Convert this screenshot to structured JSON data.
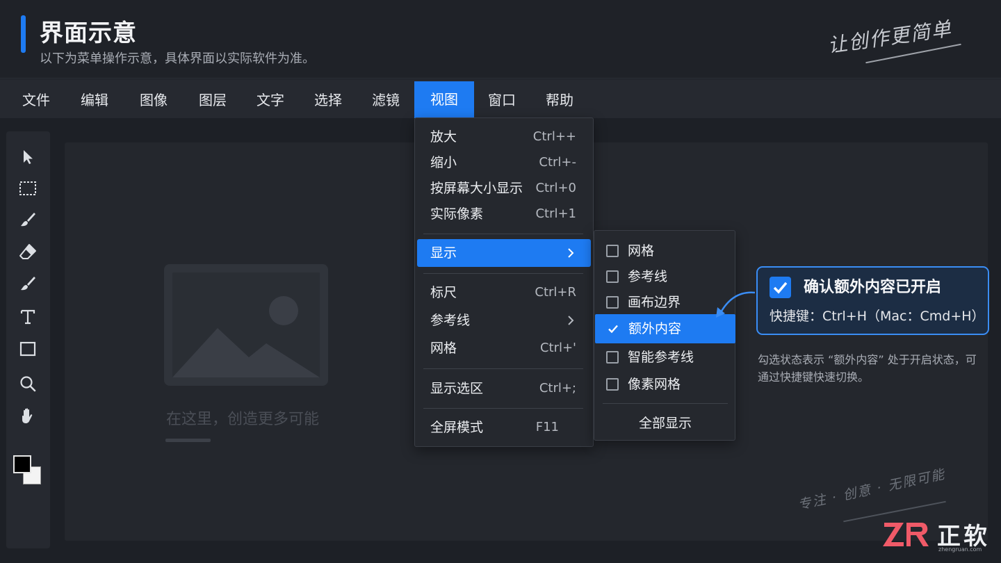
{
  "header": {
    "title": "界面示意",
    "subtitle": "以下为菜单操作示意，具体界面以实际软件为准。",
    "slogan": "让创作更简单"
  },
  "menubar": {
    "items": [
      {
        "label": "文件"
      },
      {
        "label": "编辑"
      },
      {
        "label": "图像"
      },
      {
        "label": "图层"
      },
      {
        "label": "文字"
      },
      {
        "label": "选择"
      },
      {
        "label": "滤镜"
      },
      {
        "label": "视图",
        "active": true
      },
      {
        "label": "窗口"
      },
      {
        "label": "帮助"
      }
    ]
  },
  "toolbar": {
    "tools": [
      "pointer-icon",
      "marquee-icon",
      "brush-icon",
      "eraser-icon",
      "paint-brush-icon",
      "text-tool-icon",
      "rectangle-icon",
      "zoom-icon",
      "hand-icon"
    ]
  },
  "canvas": {
    "placeholder_caption": "在这里，创造更多可能"
  },
  "view_menu": {
    "items": [
      {
        "label": "放大",
        "shortcut": "Ctrl++"
      },
      {
        "label": "缩小",
        "shortcut": "Ctrl+-"
      },
      {
        "label": "按屏幕大小显示",
        "shortcut": "Ctrl+0"
      },
      {
        "label": "实际像素",
        "shortcut": "Ctrl+1"
      },
      {
        "label": "显示",
        "submenu": true,
        "highlighted": true
      },
      {
        "label": "标尺",
        "shortcut": "Ctrl+R"
      },
      {
        "label": "参考线",
        "submenu": true
      },
      {
        "label": "网格",
        "shortcut": "Ctrl+'"
      },
      {
        "label": "显示选区",
        "shortcut": "Ctrl+;"
      },
      {
        "label": "全屏模式",
        "shortcut": "F11"
      }
    ]
  },
  "show_submenu": {
    "items": [
      {
        "label": "网格",
        "checked": false
      },
      {
        "label": "参考线",
        "checked": false
      },
      {
        "label": "画布边界",
        "checked": false
      },
      {
        "label": "额外内容",
        "checked": true,
        "highlighted": true
      },
      {
        "label": "智能参考线",
        "checked": false
      },
      {
        "label": "像素网格",
        "checked": false
      }
    ],
    "show_all": "全部显示"
  },
  "callout": {
    "title": "确认额外内容已开启",
    "shortcut": "快捷键：Ctrl+H（Mac：Cmd+H）",
    "note": "勾选状态表示 “额外内容” 处于开启状态，可通过快捷键快速切换。"
  },
  "footer": {
    "tagline": "专注 · 创意 · 无限可能",
    "logo_text": "正软",
    "logo_url": "zhengruan.com"
  },
  "colors": {
    "accent": "#1e7bf2",
    "background": "#1d2026",
    "menu_bg": "#262930"
  }
}
